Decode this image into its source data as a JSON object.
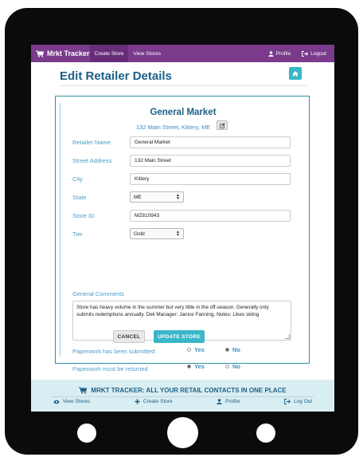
{
  "navbar": {
    "brand": "Mrkt Tracker",
    "links": [
      "Create Store",
      "View Stores"
    ],
    "profile": "Profile",
    "logout": "Logout"
  },
  "page": {
    "title": "Edit Retailer Details"
  },
  "store": {
    "name": "General Market",
    "address": "132 Main Street, Kittery, ME"
  },
  "form": {
    "retailer_name": {
      "label": "Retailer Name",
      "value": "General Market"
    },
    "street_address": {
      "label": "Street Address",
      "value": "132 Main Street"
    },
    "city": {
      "label": "City",
      "value": "Kittery"
    },
    "state": {
      "label": "State",
      "value": "ME"
    },
    "store_id": {
      "label": "Store ID",
      "value": "MZ810943"
    },
    "tier": {
      "label": "Tier",
      "value": "Gold"
    },
    "comments": {
      "label": "General Comments",
      "value": "Store has heavy volume in the summer but very little in the off-season. Generally only submits redemptions annually. Deli Manager: Janice Fanning, Notes: Likes skiing"
    },
    "paperwork_submitted": {
      "label": "Paperwork has been submitted",
      "yes": "Yes",
      "no": "No",
      "selected": "No"
    },
    "paperwork_returned": {
      "label": "Paperwork must be returned",
      "yes": "Yes",
      "no": "No",
      "selected": "Yes"
    },
    "cancel_label": "CANCEL",
    "update_label": "UPDATE STORE"
  },
  "footer": {
    "tagline": "MRKT TRACKER: ALL YOUR RETAIL CONTACTS IN ONE PLACE",
    "links": [
      "View Stores",
      "Create Store",
      "Profile",
      "Log Out"
    ]
  },
  "colors": {
    "nav": "#7a3b8c",
    "accent": "#3bb6c9",
    "heading": "#1c5f87",
    "footer": "#d9eef2"
  }
}
